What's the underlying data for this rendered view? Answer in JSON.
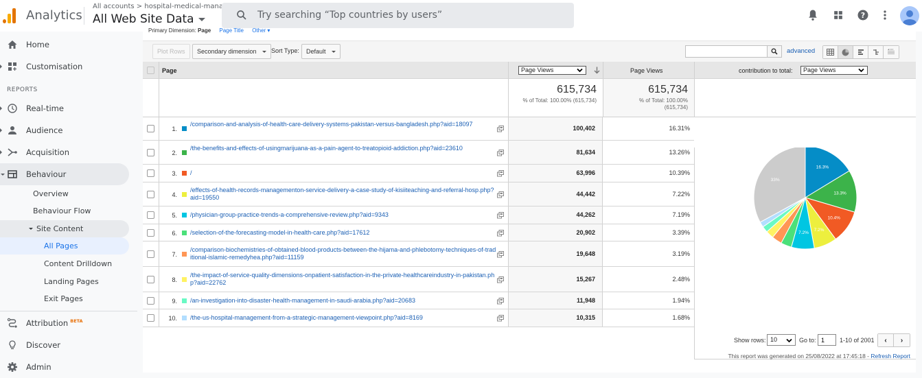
{
  "header": {
    "app_name": "Analytics",
    "breadcrumb": "All accounts > hospital-medical-mana...",
    "property": "All Web Site Data",
    "search_placeholder": "Try searching “Top countries by users”",
    "icons": [
      "bell-icon",
      "apps-grid-icon",
      "help-icon",
      "more-vert-icon",
      "account-avatar"
    ]
  },
  "sidebar": {
    "items": [
      {
        "label": "Home",
        "icon": "home-icon"
      },
      {
        "label": "Customisation",
        "icon": "dashboard-icon"
      }
    ],
    "section_label": "REPORTS",
    "reports": [
      {
        "label": "Real-time",
        "icon": "clock-icon"
      },
      {
        "label": "Audience",
        "icon": "person-icon"
      },
      {
        "label": "Acquisition",
        "icon": "acquisition-icon"
      },
      {
        "label": "Behaviour",
        "icon": "behaviour-icon"
      }
    ],
    "behaviour_sub": [
      "Overview",
      "Behaviour Flow"
    ],
    "site_content_label": "Site Content",
    "site_content_sub": [
      "All Pages",
      "Content Drilldown",
      "Landing Pages",
      "Exit Pages"
    ],
    "bottom": [
      {
        "label": "Attribution",
        "badge": "BETA",
        "icon": "attribution-icon"
      },
      {
        "label": "Discover",
        "icon": "lightbulb-icon"
      },
      {
        "label": "Admin",
        "icon": "gear-icon"
      }
    ]
  },
  "report": {
    "primary_dimension_label": "Primary Dimension:",
    "primary_dimension_value": "Page",
    "primary_dimension_alt": "Page Title",
    "primary_dimension_other": "Other ▾",
    "toolbar": {
      "plot_rows": "Plot Rows",
      "secondary_dimension": "Secondary dimension",
      "sort_type_label": "Sort Type:",
      "sort_type_value": "Default",
      "search_value": "",
      "advanced": "advanced"
    },
    "columns": {
      "page": "Page",
      "metric_select": "Page Views",
      "metric": "Page Views",
      "contribution_label": "contribution to total:",
      "contribution_select": "Page Views"
    },
    "totals": {
      "value": "615,734",
      "note1": "% of Total: 100.00% (615,734)",
      "value2": "615,734",
      "note2a": "% of Total: 100.00%",
      "note2b": "(615,734)"
    },
    "rows": [
      {
        "rank": "1.",
        "page": "/comparison-and-analysis-of-health-care-delivery-systems-pakistan-versus-bangladesh.php?aid=18097",
        "views": "100,402",
        "pct": "16.31%",
        "color": "#058dc7"
      },
      {
        "rank": "2.",
        "page": "/the-benefits-and-effects-of-usingmarijuana-as-a-pain-agent-to-treatopioid-addiction.php?aid=23610",
        "views": "81,634",
        "pct": "13.26%",
        "color": "#3cb34a"
      },
      {
        "rank": "3.",
        "page": "/",
        "views": "63,996",
        "pct": "10.39%",
        "color": "#f15a24"
      },
      {
        "rank": "4.",
        "page": "/effects-of-health-records-managementon-service-delivery-a-case-study-of-kisiiteaching-and-referral-hosp.php?aid=19550",
        "views": "44,442",
        "pct": "7.22%",
        "color": "#edef3e"
      },
      {
        "rank": "5.",
        "page": "/physician-group-practice-trends-a-comprehensive-review.php?aid=9343",
        "views": "44,262",
        "pct": "7.19%",
        "color": "#00c6e2"
      },
      {
        "rank": "6.",
        "page": "/selection-of-the-forecasting-model-in-health-care.php?aid=17612",
        "views": "20,902",
        "pct": "3.39%",
        "color": "#4be07a"
      },
      {
        "rank": "7.",
        "page": "/comparison-biochemistries-of-obtained-blood-products-between-the-hijama-and-phlebotomy-techniques-of-traditional-islamic-remedyhea.php?aid=11159",
        "views": "19,648",
        "pct": "3.19%",
        "color": "#ff9655"
      },
      {
        "rank": "8.",
        "page": "/the-impact-of-service-quality-dimensions-onpatient-satisfaction-in-the-private-healthcareindustry-in-pakistan.php?aid=22762",
        "views": "15,267",
        "pct": "2.48%",
        "color": "#fff263"
      },
      {
        "rank": "9.",
        "page": "/an-investigation-into-disaster-health-management-in-saudi-arabia.php?aid=20683",
        "views": "11,948",
        "pct": "1.94%",
        "color": "#6af9c4"
      },
      {
        "rank": "10.",
        "page": "/the-us-hospital-management-from-a-strategic-management-viewpoint.php?aid=8169",
        "views": "10,315",
        "pct": "1.68%",
        "color": "#b2deff"
      }
    ],
    "footer": {
      "show_rows_label": "Show rows:",
      "show_rows_value": "10",
      "goto_label": "Go to:",
      "goto_value": "1",
      "range": "1-10 of 2001",
      "generated": "This report was generated on 25/08/2022 at 17:45:18 - ",
      "refresh": "Refresh Report"
    }
  },
  "chart_data": {
    "type": "pie",
    "title": "contribution to total: Page Views",
    "categories": [
      "Row 1",
      "Row 2",
      "Row 3",
      "Row 4",
      "Row 5",
      "Row 6",
      "Row 7",
      "Row 8",
      "Row 9",
      "Row 10",
      "Other"
    ],
    "values": [
      16.31,
      13.26,
      10.39,
      7.22,
      7.19,
      3.39,
      3.19,
      2.48,
      1.94,
      1.68,
      32.95
    ],
    "colors": [
      "#058dc7",
      "#3cb34a",
      "#f15a24",
      "#edef3e",
      "#00c6e2",
      "#4be07a",
      "#ff9655",
      "#fff263",
      "#6af9c4",
      "#b2deff",
      "#cccccc"
    ],
    "data_labels": [
      "16.3%",
      "13.3%",
      "10.4%",
      "7.2%",
      "7.2%",
      "",
      "",
      "",
      "",
      "",
      "33%"
    ],
    "legend": "none"
  }
}
